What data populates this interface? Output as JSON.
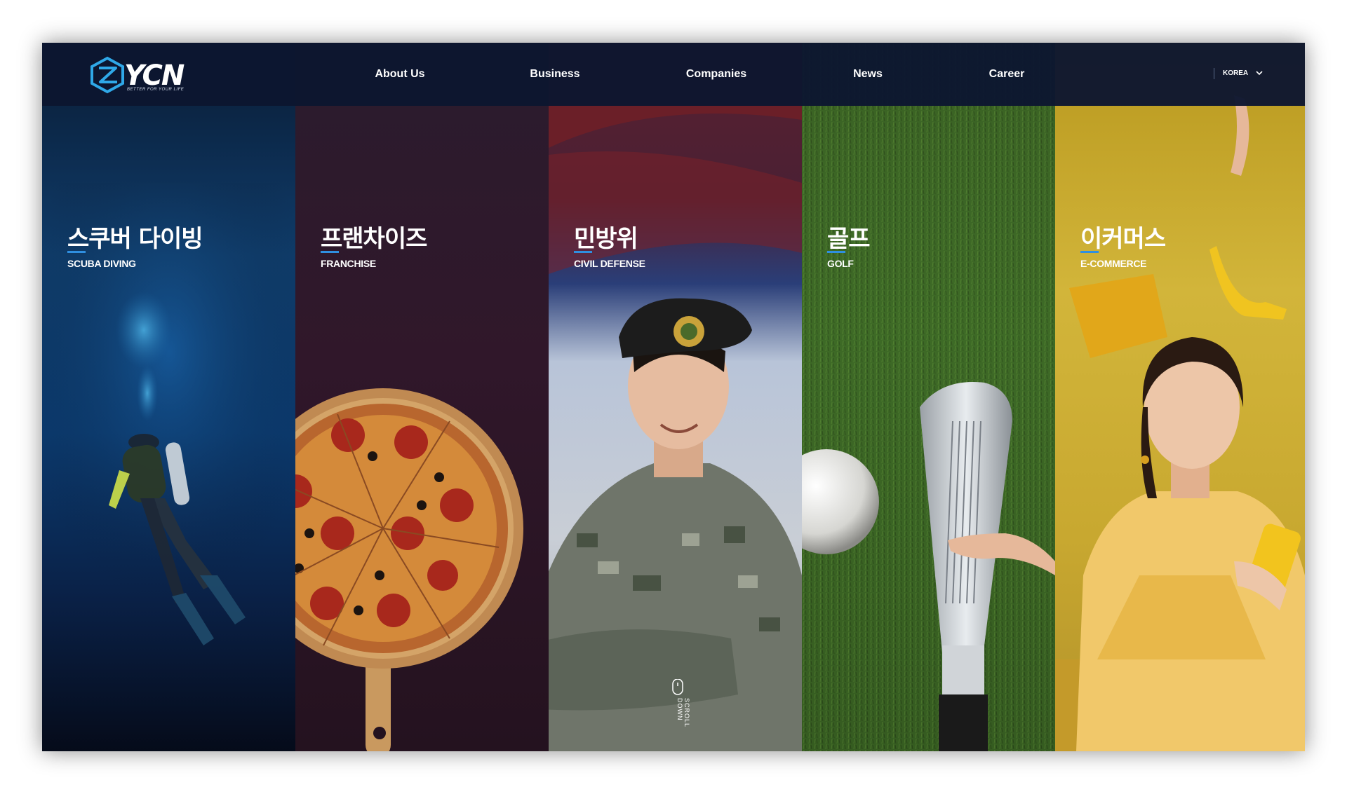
{
  "brand": {
    "logo_text": "YCN",
    "tagline": "BETTER FOR YOUR LIFE"
  },
  "nav": {
    "items": [
      {
        "label": "About Us"
      },
      {
        "label": "Business"
      },
      {
        "label": "Companies"
      },
      {
        "label": "News"
      },
      {
        "label": "Career"
      }
    ]
  },
  "language": {
    "selected": "KOREA"
  },
  "panels": [
    {
      "title": "스쿠버 다이빙",
      "subtitle": "SCUBA DIVING",
      "image_icon": "scuba-diver"
    },
    {
      "title": "프랜차이즈",
      "subtitle": "FRANCHISE",
      "image_icon": "pizza"
    },
    {
      "title": "민방위",
      "subtitle": "CIVIL DEFENSE",
      "image_icon": "soldier"
    },
    {
      "title": "골프",
      "subtitle": "GOLF",
      "image_icon": "golf-club-ball"
    },
    {
      "title": "이커머스",
      "subtitle": "E-COMMERCE",
      "image_icon": "woman-phone"
    }
  ],
  "scroll_hint": "SCROLL DOWN",
  "colors": {
    "header_bg": "#0c1630",
    "accent_underline": "#2f8fe0",
    "logo_accent": "#2fa8e8"
  }
}
